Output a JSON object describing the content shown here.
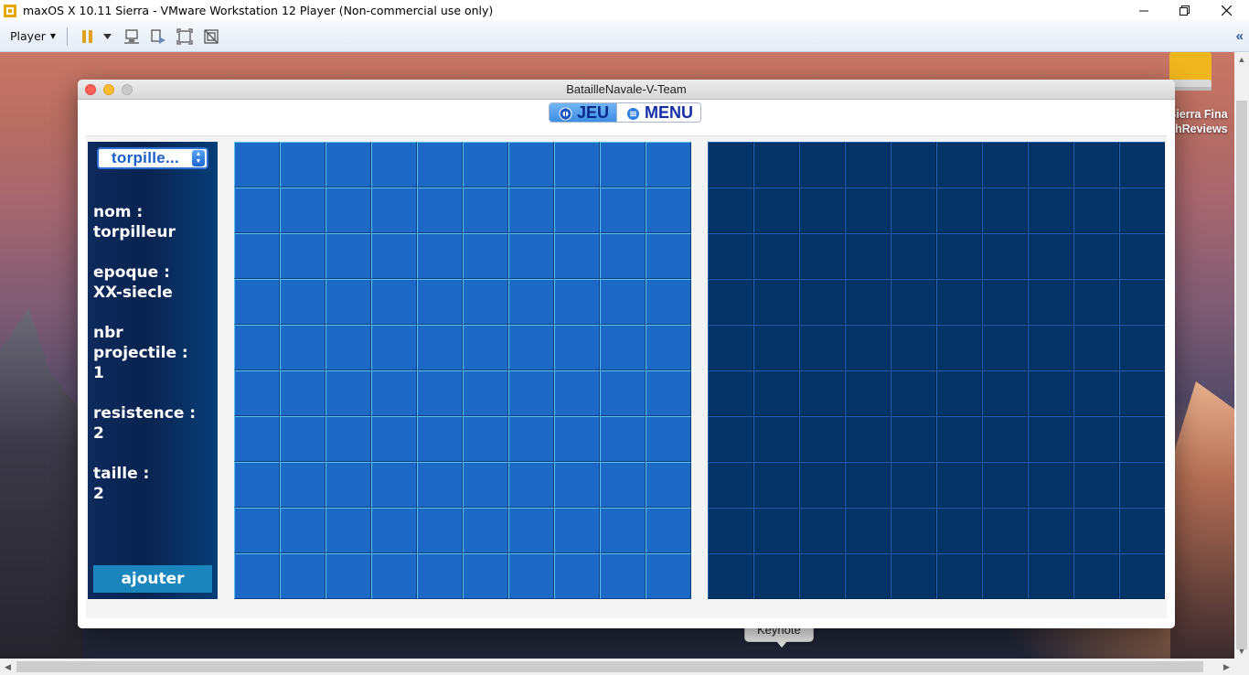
{
  "host": {
    "title": "maxOS X 10.11 Sierra - VMware Workstation 12 Player (Non-commercial use only)",
    "player_menu": "Player",
    "toolbar_icons": [
      "pause-icon",
      "dropdown-icon",
      "send-ctrl-alt-del-icon",
      "removable-devices-icon",
      "fullscreen-icon",
      "unity-icon"
    ]
  },
  "desktop": {
    "drive_label_line1": "Sierra Fina",
    "drive_label_line2": "chReviews",
    "dock_tooltip": "Keynote"
  },
  "app": {
    "window_title": "BatailleNavale-V-Team",
    "tabs": [
      {
        "label": "JEU",
        "icon": "game-icon",
        "active": true
      },
      {
        "label": "MENU",
        "icon": "menu-icon",
        "active": false
      }
    ],
    "ship_select": {
      "value": "torpille..."
    },
    "attributes": {
      "nom_label": "nom :",
      "nom_value": "torpilleur",
      "epoque_label": "epoque :",
      "epoque_value": "XX-siecle",
      "nbr_label_1": "nbr",
      "nbr_label_2": "projectile :",
      "nbr_value": "1",
      "resistence_label": "resistence :",
      "resistence_value": "2",
      "taille_label": "taille :",
      "taille_value": "2"
    },
    "add_button": "ajouter",
    "grid_size": 10,
    "colors": {
      "player_cell": "#1c69c6",
      "enemy_cell": "#043467",
      "add_button": "#1b86bd"
    }
  }
}
